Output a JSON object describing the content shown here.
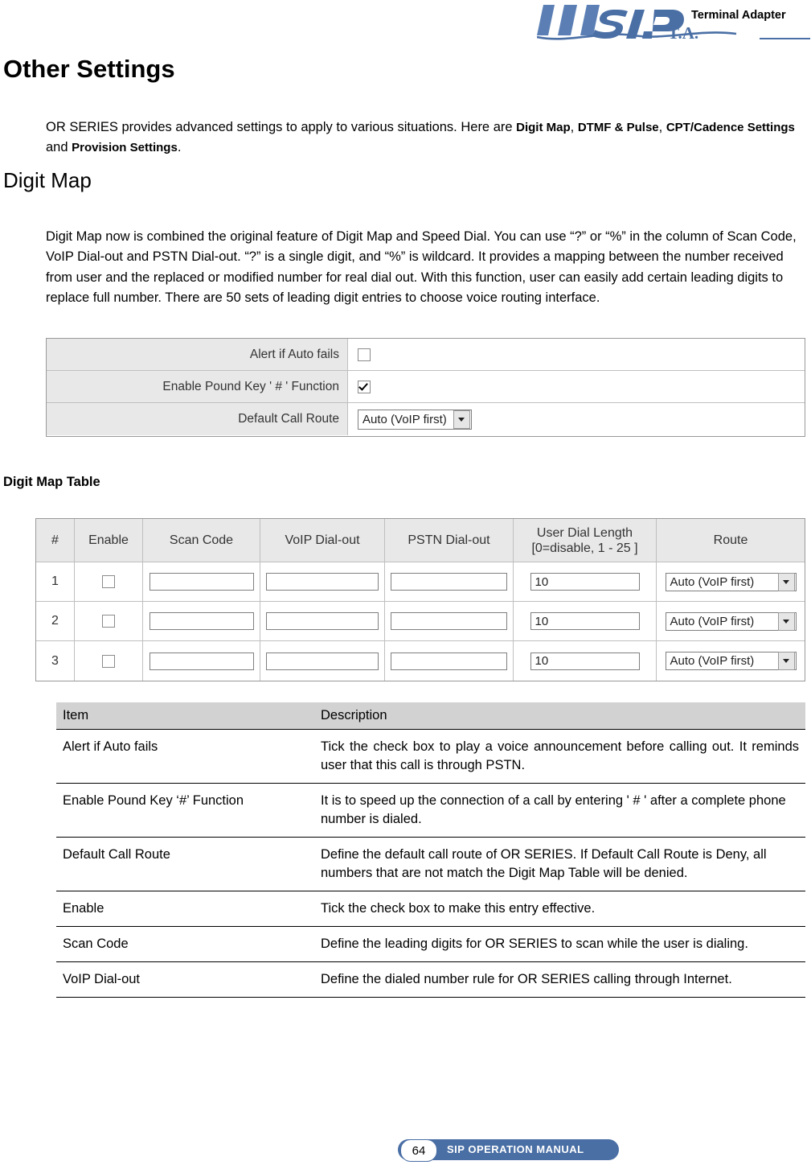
{
  "header": {
    "brand": "SIP",
    "product_label": "Terminal Adapter",
    "ta_mark": "T.A."
  },
  "page_title": "Other Settings",
  "intro": {
    "text_1": "OR SERIES provides advanced settings to apply to various situations. Here are ",
    "bold_1": "Digit Map",
    "text_2": ", ",
    "bold_2": "DTMF & Pulse",
    "text_3": ", ",
    "bold_3": "CPT/Cadence Settings",
    "text_4": " and ",
    "bold_4": "Provision Settings",
    "text_5": "."
  },
  "section_title": "Digit Map",
  "section_paragraph": "Digit Map now is combined the original feature of Digit Map and Speed Dial. You can use “?” or “%” in the column of Scan Code, VoIP Dial-out and PSTN Dial-out. “?” is a single digit, and “%” is wildcard. It provides a mapping between the number received from user and the replaced or modified number for real dial out. With this function, user can easily add certain leading digits to replace full number. There are 50 sets of leading digit entries to choose voice routing interface.",
  "settings_panel": {
    "rows": [
      {
        "label": "Alert if Auto fails",
        "control": "checkbox",
        "checked": false
      },
      {
        "label": "Enable Pound Key ' # ' Function",
        "control": "checkbox",
        "checked": true
      },
      {
        "label": "Default Call Route",
        "control": "select",
        "value": "Auto (VoIP first)"
      }
    ]
  },
  "digit_map_table_title": "Digit Map Table",
  "digit_map_table": {
    "headers": {
      "num": "#",
      "enable": "Enable",
      "scan_code": "Scan Code",
      "voip_dial_out": "VoIP Dial-out",
      "pstn_dial_out": "PSTN Dial-out",
      "user_dial_length_1": "User Dial Length",
      "user_dial_length_2": "[0=disable, 1 - 25 ]",
      "route": "Route"
    },
    "rows": [
      {
        "num": "1",
        "enabled": false,
        "scan_code": "",
        "voip_dial_out": "",
        "pstn_dial_out": "",
        "user_dial_length": "10",
        "route": "Auto (VoIP first)"
      },
      {
        "num": "2",
        "enabled": false,
        "scan_code": "",
        "voip_dial_out": "",
        "pstn_dial_out": "",
        "user_dial_length": "10",
        "route": "Auto (VoIP first)"
      },
      {
        "num": "3",
        "enabled": false,
        "scan_code": "",
        "voip_dial_out": "",
        "pstn_dial_out": "",
        "user_dial_length": "10",
        "route": "Auto (VoIP first)"
      }
    ]
  },
  "description_table": {
    "headers": {
      "item": "Item",
      "description": "Description"
    },
    "rows": [
      {
        "item": "Alert if Auto fails",
        "description": "Tick the check box to play a voice announcement before calling out. It reminds user that this call is through PSTN.",
        "justify": true
      },
      {
        "item": "Enable Pound Key ‘#’ Function",
        "description": "It is to speed up the connection of a call by entering ' # ' after a complete phone number is dialed.",
        "justify": false
      },
      {
        "item": "Default Call Route",
        "description": "Define the default call route of OR SERIES. If Default Call Route is Deny, all numbers that are not match the Digit Map Table will be denied.",
        "justify": false
      },
      {
        "item": "Enable",
        "description": "Tick the check box to make this entry effective.",
        "justify": false
      },
      {
        "item": "Scan Code",
        "description": "Define the leading digits for OR SERIES to scan while the user is dialing.",
        "justify": false
      },
      {
        "item": "VoIP Dial-out",
        "description": "Define the dialed number rule for OR SERIES calling through Internet.",
        "justify": false
      }
    ]
  },
  "footer": {
    "page_number": "64",
    "manual_label": "SIP OPERATION MANUAL"
  }
}
